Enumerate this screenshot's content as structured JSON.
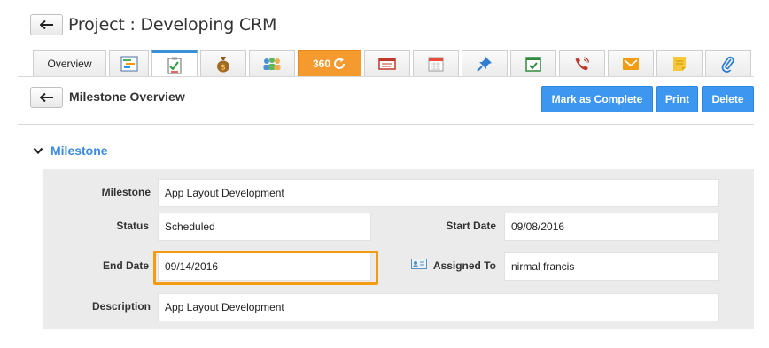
{
  "header": {
    "project_title": "Project : Developing CRM"
  },
  "tabs": [
    {
      "label": "Overview",
      "icon": "overview"
    },
    {
      "label": "",
      "icon": "gantt-chart-icon"
    },
    {
      "label": "",
      "icon": "milestone-checklist-icon",
      "active": true
    },
    {
      "label": "",
      "icon": "money-bag-icon"
    },
    {
      "label": "",
      "icon": "team-icon"
    },
    {
      "label": "360",
      "icon": "refresh-360-icon"
    },
    {
      "label": "",
      "icon": "card-list-icon"
    },
    {
      "label": "",
      "icon": "calendar-icon"
    },
    {
      "label": "",
      "icon": "pin-icon"
    },
    {
      "label": "",
      "icon": "task-check-icon"
    },
    {
      "label": "",
      "icon": "phone-call-icon"
    },
    {
      "label": "",
      "icon": "mail-icon"
    },
    {
      "label": "",
      "icon": "sticky-note-icon"
    },
    {
      "label": "",
      "icon": "attachment-icon"
    }
  ],
  "subheader": {
    "title": "Milestone Overview",
    "buttons": {
      "complete": "Mark as Complete",
      "print": "Print",
      "delete": "Delete"
    }
  },
  "section": {
    "title": "Milestone"
  },
  "fields": {
    "milestone": {
      "label": "Milestone",
      "value": "App Layout Development"
    },
    "status": {
      "label": "Status",
      "value": "Scheduled"
    },
    "start_date": {
      "label": "Start Date",
      "value": "09/08/2016"
    },
    "end_date": {
      "label": "End Date",
      "value": "09/14/2016"
    },
    "assigned_to": {
      "label": "Assigned To",
      "value": "nirmal francis"
    },
    "description": {
      "label": "Description",
      "value": "App Layout Development"
    }
  },
  "colors": {
    "accent": "#3d96f0",
    "highlight": "#f39c12",
    "tab_360": "#f59a2f",
    "section_title": "#3d8be0"
  }
}
